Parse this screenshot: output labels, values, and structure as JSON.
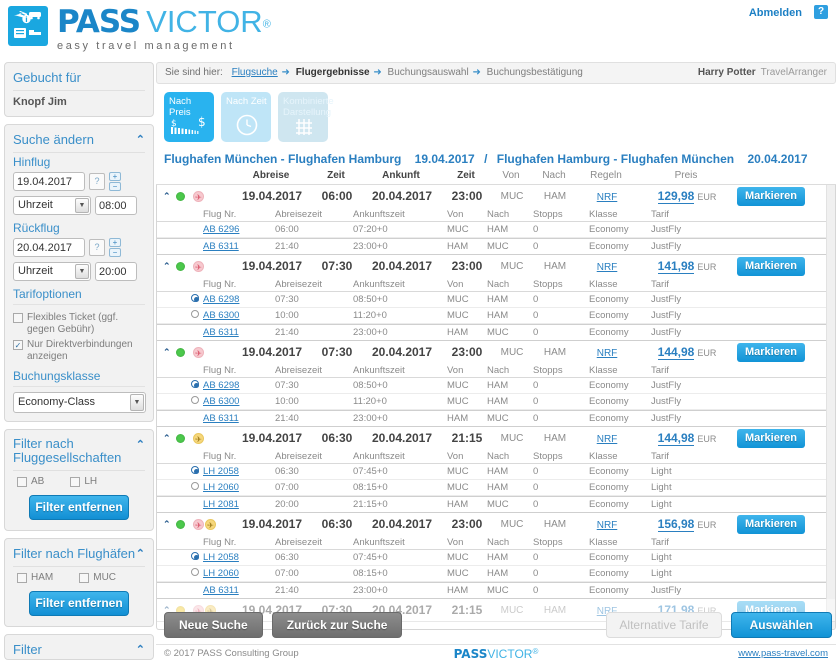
{
  "header": {
    "logo_pass": "PASS",
    "logo_victor": "VICTOR",
    "logo_reg": "®",
    "tagline": "easy travel management",
    "logout_label": "Abmelden",
    "help_label": "?"
  },
  "sidebar": {
    "booked_for": {
      "title": "Gebucht für",
      "person": "Knopf Jim"
    },
    "search_change": {
      "title": "Suche ändern",
      "outbound_label": "Hinflug",
      "outbound_date": "19.04.2017",
      "outbound_time_select": "Uhrzeit",
      "outbound_time": "08:00",
      "return_label": "Rückflug",
      "return_date": "20.04.2017",
      "return_time_select": "Uhrzeit",
      "return_time": "20:00",
      "fare_options_label": "Tarifoptionen",
      "flex_ticket_label": "Flexibles Ticket (ggf. gegen Gebühr)",
      "flex_ticket_checked": false,
      "direct_only_label": "Nur Direktverbindungen anzeigen",
      "direct_only_checked": true,
      "booking_class_label": "Buchungsklasse",
      "booking_class_value": "Economy-Class",
      "calendar_icon": "?",
      "plus_icon": "+",
      "minus_icon": "−"
    },
    "filter_airlines": {
      "title": "Filter nach Fluggesellschaften",
      "options": [
        "AB",
        "LH"
      ],
      "button": "Filter entfernen"
    },
    "filter_airports": {
      "title": "Filter nach Flughäfen",
      "options": [
        "HAM",
        "MUC"
      ],
      "button": "Filter entfernen"
    },
    "filter_generic": {
      "title": "Filter"
    }
  },
  "breadcrumb": {
    "lead": "Sie sind hier:",
    "steps": [
      "Flugsuche",
      "Flugergebnisse",
      "Buchungsauswahl",
      "Buchungsbestätigung"
    ],
    "current_index": 1,
    "arrow": "➜",
    "user_name": "Harry Potter",
    "user_role": "TravelArranger"
  },
  "sort_buttons": [
    {
      "label": "Nach Preis",
      "state": "active",
      "icon": "price-icon"
    },
    {
      "label": "Nach Zeit",
      "state": "light",
      "icon": "clock-icon"
    },
    {
      "label": "Kombinierte Darstellung",
      "state": "muted",
      "icon": "grid-icon"
    }
  ],
  "route": {
    "outbound": "Flughafen München - Flughafen Hamburg",
    "outbound_date": "19.04.2017",
    "separator": "/",
    "return": "Flughafen Hamburg - Flughafen München",
    "return_date": "20.04.2017"
  },
  "table": {
    "main_headers": [
      "Abreise",
      "Zeit",
      "Ankunft",
      "Zeit",
      "Von",
      "Nach",
      "Regeln",
      "Preis"
    ],
    "sub_headers": [
      "Flug Nr.",
      "Abreisezeit",
      "Ankunftszeit",
      "Von",
      "Nach",
      "Stopps",
      "Klasse",
      "Tarif"
    ],
    "mark_label": "Markieren",
    "currency": "EUR"
  },
  "results": [
    {
      "status": "green",
      "airlines": [
        "AB"
      ],
      "dep_date": "19.04.2017",
      "dep_time": "06:00",
      "arr_date": "20.04.2017",
      "arr_time": "23:00",
      "from": "MUC",
      "to": "HAM",
      "rules": "NRF",
      "price": "129,98",
      "legs": [
        {
          "radio": null,
          "flight": "AB 6296",
          "dep": "06:00",
          "arr": "07:20+0",
          "from": "MUC",
          "to": "HAM",
          "stops": "0",
          "class": "Economy",
          "fare": "JustFly",
          "group": 1
        },
        {
          "radio": null,
          "flight": "AB 6311",
          "dep": "21:40",
          "arr": "23:00+0",
          "from": "HAM",
          "to": "MUC",
          "stops": "0",
          "class": "Economy",
          "fare": "JustFly",
          "group": 2
        }
      ]
    },
    {
      "status": "green",
      "airlines": [
        "AB"
      ],
      "dep_date": "19.04.2017",
      "dep_time": "07:30",
      "arr_date": "20.04.2017",
      "arr_time": "23:00",
      "from": "MUC",
      "to": "HAM",
      "rules": "NRF",
      "price": "141,98",
      "legs": [
        {
          "radio": "on",
          "flight": "AB 6298",
          "dep": "07:30",
          "arr": "08:50+0",
          "from": "MUC",
          "to": "HAM",
          "stops": "0",
          "class": "Economy",
          "fare": "JustFly",
          "group": 1
        },
        {
          "radio": "off",
          "flight": "AB 6300",
          "dep": "10:00",
          "arr": "11:20+0",
          "from": "MUC",
          "to": "HAM",
          "stops": "0",
          "class": "Economy",
          "fare": "JustFly",
          "group": 1
        },
        {
          "radio": null,
          "flight": "AB 6311",
          "dep": "21:40",
          "arr": "23:00+0",
          "from": "HAM",
          "to": "MUC",
          "stops": "0",
          "class": "Economy",
          "fare": "JustFly",
          "group": 2
        }
      ]
    },
    {
      "status": "green",
      "airlines": [
        "AB"
      ],
      "dep_date": "19.04.2017",
      "dep_time": "07:30",
      "arr_date": "20.04.2017",
      "arr_time": "23:00",
      "from": "MUC",
      "to": "HAM",
      "rules": "NRF",
      "price": "144,98",
      "legs": [
        {
          "radio": "on",
          "flight": "AB 6298",
          "dep": "07:30",
          "arr": "08:50+0",
          "from": "MUC",
          "to": "HAM",
          "stops": "0",
          "class": "Economy",
          "fare": "JustFly",
          "group": 1
        },
        {
          "radio": "off",
          "flight": "AB 6300",
          "dep": "10:00",
          "arr": "11:20+0",
          "from": "MUC",
          "to": "HAM",
          "stops": "0",
          "class": "Economy",
          "fare": "JustFly",
          "group": 1
        },
        {
          "radio": null,
          "flight": "AB 6311",
          "dep": "21:40",
          "arr": "23:00+0",
          "from": "HAM",
          "to": "MUC",
          "stops": "0",
          "class": "Economy",
          "fare": "JustFly",
          "group": 2
        }
      ]
    },
    {
      "status": "green",
      "airlines": [
        "LH"
      ],
      "dep_date": "19.04.2017",
      "dep_time": "06:30",
      "arr_date": "20.04.2017",
      "arr_time": "21:15",
      "from": "MUC",
      "to": "HAM",
      "rules": "NRF",
      "price": "144,98",
      "legs": [
        {
          "radio": "on",
          "flight": "LH 2058",
          "dep": "06:30",
          "arr": "07:45+0",
          "from": "MUC",
          "to": "HAM",
          "stops": "0",
          "class": "Economy",
          "fare": "Light",
          "group": 1
        },
        {
          "radio": "off",
          "flight": "LH 2060",
          "dep": "07:00",
          "arr": "08:15+0",
          "from": "MUC",
          "to": "HAM",
          "stops": "0",
          "class": "Economy",
          "fare": "Light",
          "group": 1
        },
        {
          "radio": null,
          "flight": "LH 2081",
          "dep": "20:00",
          "arr": "21:15+0",
          "from": "HAM",
          "to": "MUC",
          "stops": "0",
          "class": "Economy",
          "fare": "Light",
          "group": 2
        }
      ]
    },
    {
      "status": "green",
      "airlines": [
        "AB",
        "LH"
      ],
      "dep_date": "19.04.2017",
      "dep_time": "06:30",
      "arr_date": "20.04.2017",
      "arr_time": "23:00",
      "from": "MUC",
      "to": "HAM",
      "rules": "NRF",
      "price": "156,98",
      "legs": [
        {
          "radio": "on",
          "flight": "LH 2058",
          "dep": "06:30",
          "arr": "07:45+0",
          "from": "MUC",
          "to": "HAM",
          "stops": "0",
          "class": "Economy",
          "fare": "Light",
          "group": 1
        },
        {
          "radio": "off",
          "flight": "LH 2060",
          "dep": "07:00",
          "arr": "08:15+0",
          "from": "MUC",
          "to": "HAM",
          "stops": "0",
          "class": "Economy",
          "fare": "Light",
          "group": 1
        },
        {
          "radio": null,
          "flight": "AB 6311",
          "dep": "21:40",
          "arr": "23:00+0",
          "from": "HAM",
          "to": "MUC",
          "stops": "0",
          "class": "Economy",
          "fare": "JustFly",
          "group": 2
        }
      ]
    },
    {
      "status": "yellow",
      "airlines": [
        "AB",
        "LH"
      ],
      "dep_date": "19.04.2017",
      "dep_time": "07:30",
      "arr_date": "20.04.2017",
      "arr_time": "21:15",
      "from": "MUC",
      "to": "HAM",
      "rules": "NRF",
      "price": "171,98",
      "partial": true,
      "legs": []
    }
  ],
  "actions": {
    "new_search": "Neue Suche",
    "back_to_search": "Zurück zur Suche",
    "alternative_fares": "Alternative Tarife",
    "select": "Auswählen"
  },
  "footer": {
    "copyright": "© 2017 PASS Consulting Group",
    "logo_pass": "PASS",
    "logo_victor": "VICTOR",
    "logo_reg": "®",
    "link": "www.pass-travel.com"
  },
  "colors": {
    "accent": "#29b3ef",
    "link": "#2a7fc0",
    "status_ok": "#4cc94c",
    "status_warn": "#f5d03a"
  }
}
